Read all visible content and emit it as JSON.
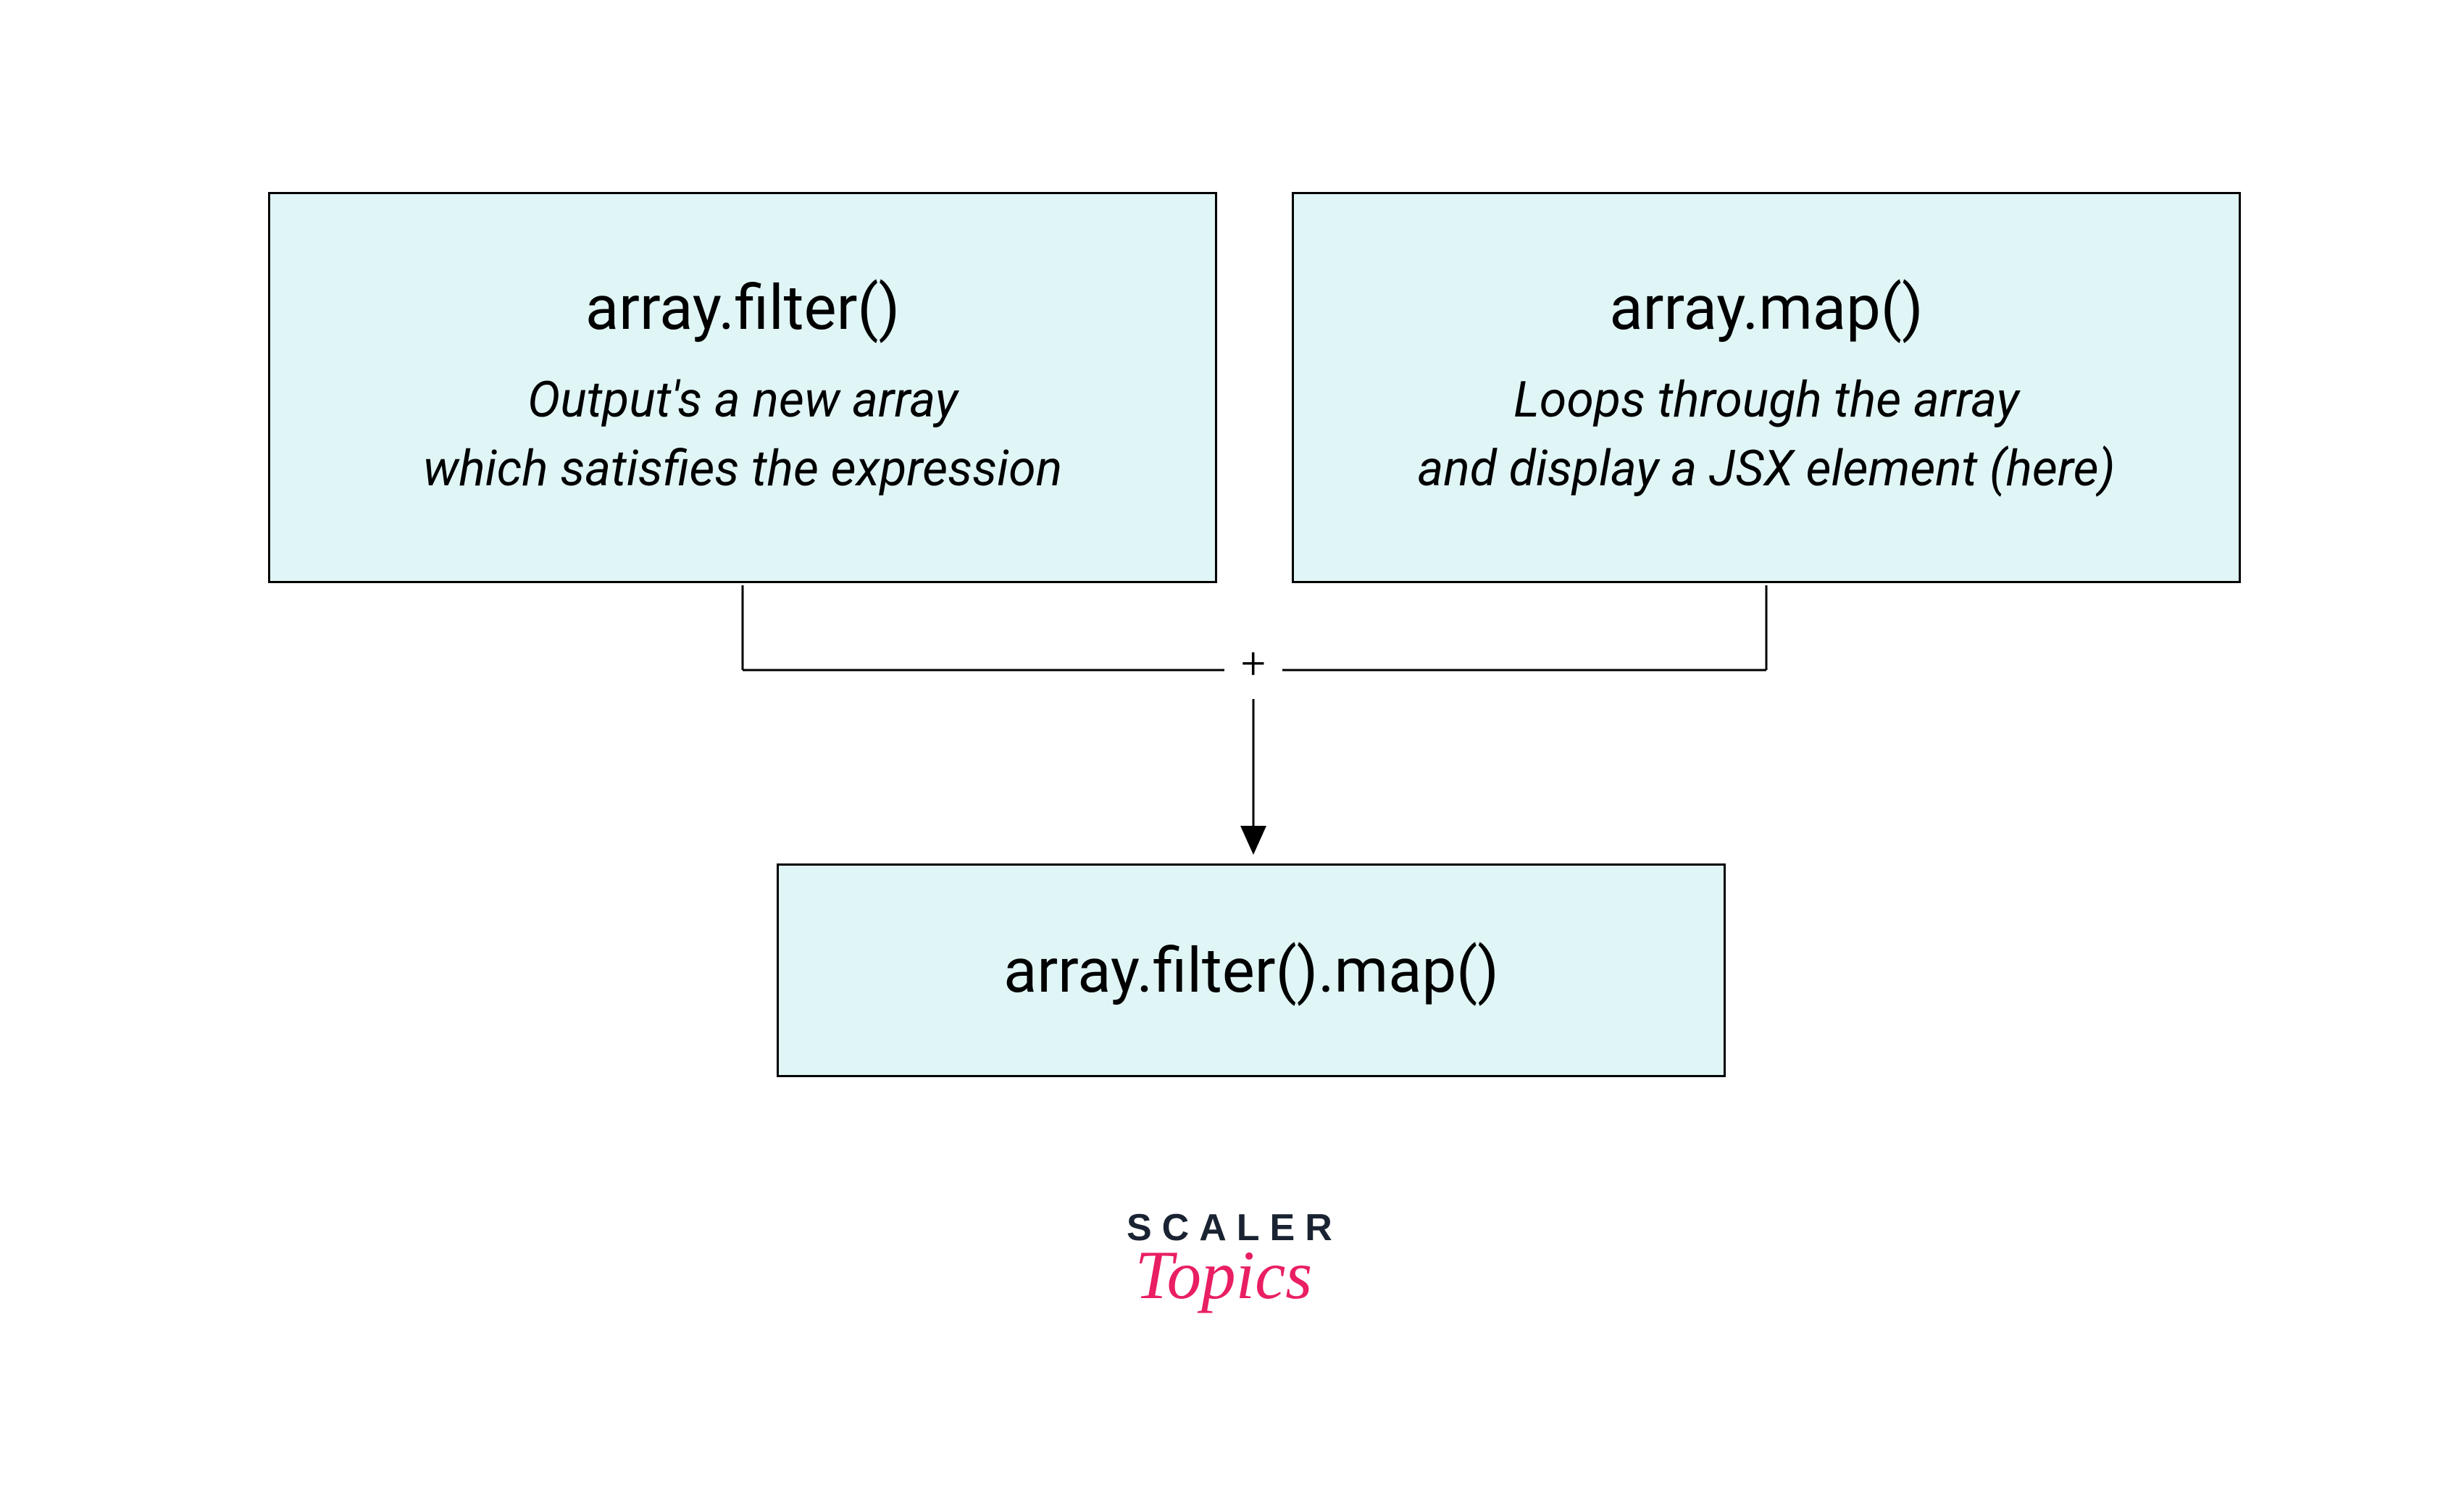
{
  "boxes": {
    "left": {
      "title": "array.filter()",
      "description_line1": "Output's a new array",
      "description_line2": "which satisfies the expression"
    },
    "right": {
      "title": "array.map()",
      "description_line1": "Loops through the array",
      "description_line2": "and display a JSX element (here)"
    },
    "bottom": {
      "title": "array.filter().map()"
    }
  },
  "connector": {
    "join_symbol": "+"
  },
  "logo": {
    "line1": "SCALER",
    "line2": "Topics"
  },
  "colors": {
    "box_fill": "#e0f5f5",
    "box_border": "#000000",
    "text": "#000000",
    "logo_primary": "#1a2332",
    "logo_accent": "#e91e63"
  }
}
